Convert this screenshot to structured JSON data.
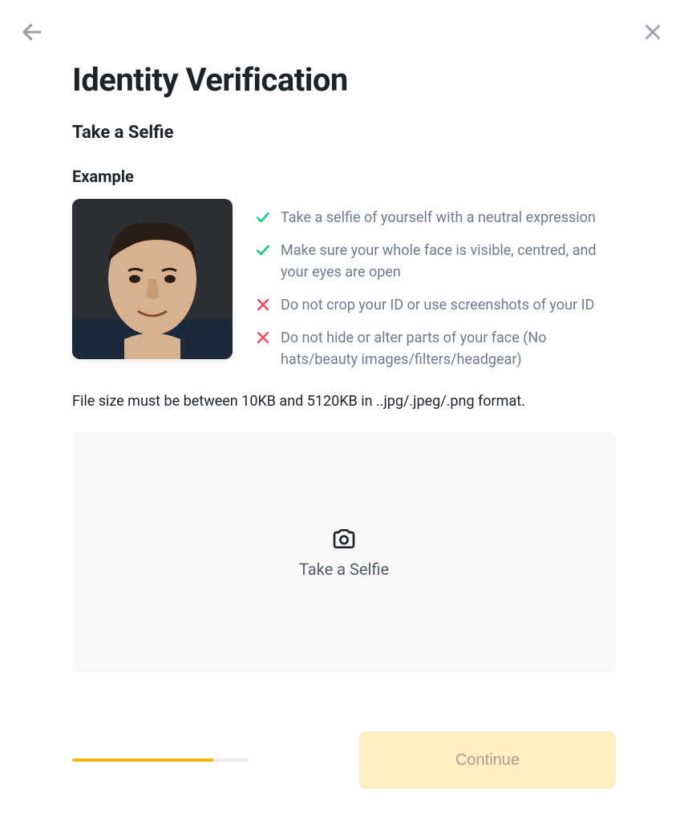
{
  "header": {
    "title": "Identity Verification"
  },
  "step": {
    "subheading": "Take a Selfie",
    "example_label": "Example"
  },
  "rules": [
    {
      "ok": true,
      "text": "Take a selfie of yourself with a neutral expression"
    },
    {
      "ok": true,
      "text": "Make sure your whole face is visible, centred, and your eyes are open"
    },
    {
      "ok": false,
      "text": "Do not crop your ID or use screenshots of your ID"
    },
    {
      "ok": false,
      "text": "Do not hide or alter parts of your face (No hats/beauty images/filters/headgear)"
    }
  ],
  "file_note": "File size must be between 10KB and 5120KB in ..jpg/.jpeg/.png format.",
  "upload": {
    "label": "Take a Selfie"
  },
  "footer": {
    "continue_label": "Continue",
    "progress_percent": 80
  },
  "colors": {
    "accent": "#f0b90b",
    "ok": "#0ecb81",
    "bad": "#f6465d"
  }
}
